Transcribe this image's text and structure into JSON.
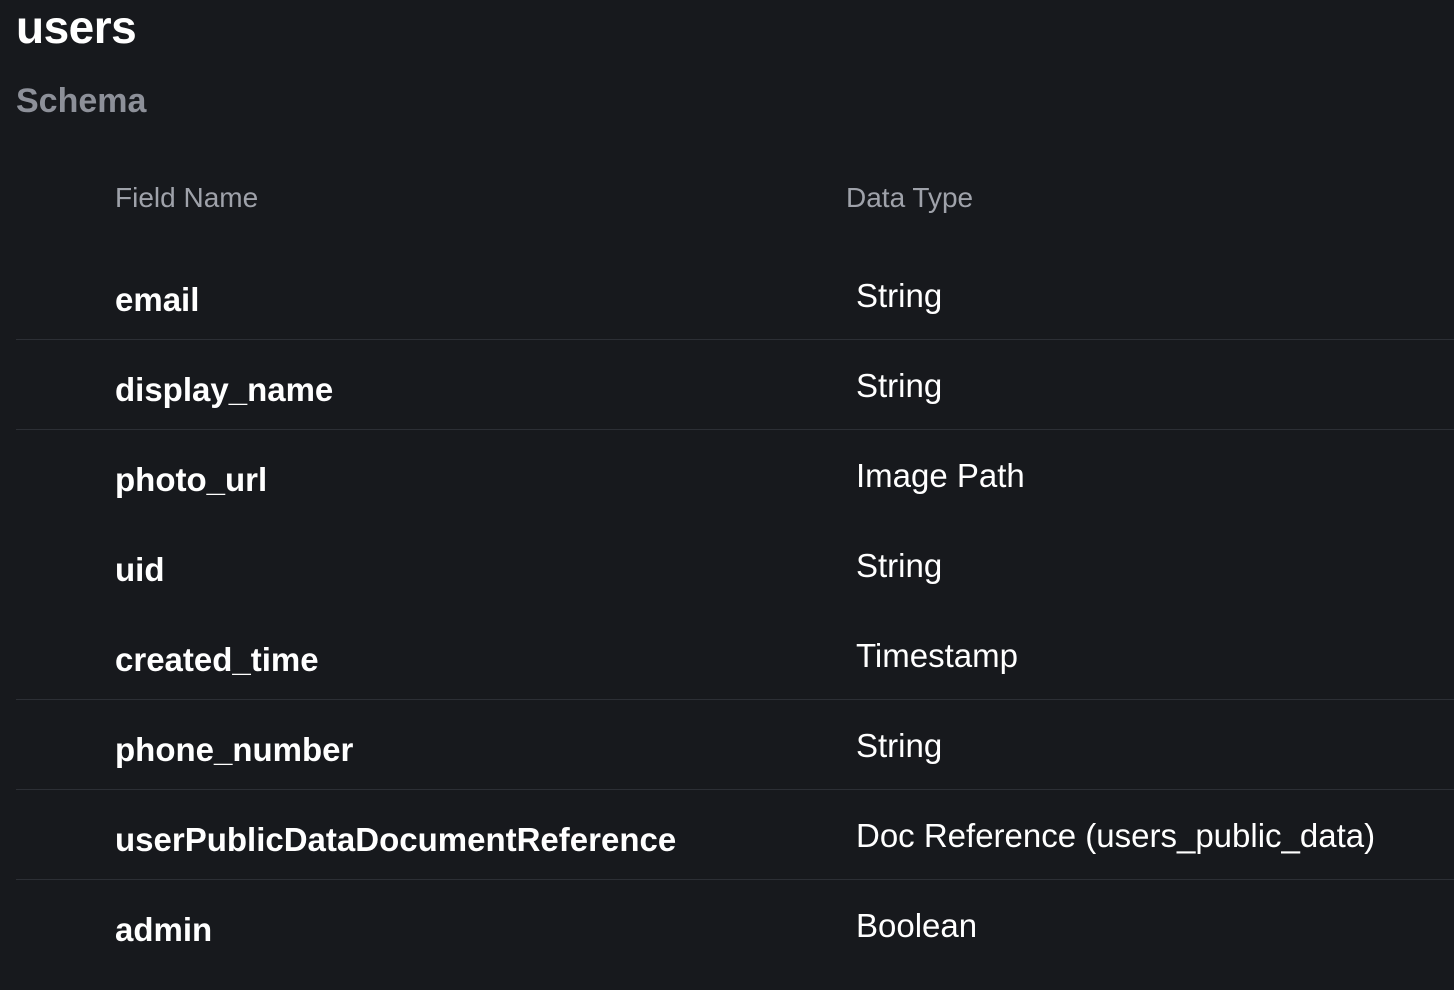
{
  "collection": {
    "title": "users",
    "section": "Schema"
  },
  "table": {
    "headers": {
      "field_name": "Field Name",
      "data_type": "Data Type"
    },
    "rows": [
      {
        "name": "email",
        "type": "String"
      },
      {
        "name": "display_name",
        "type": "String"
      },
      {
        "name": "photo_url",
        "type": "Image Path"
      },
      {
        "name": "uid",
        "type": "String"
      },
      {
        "name": "created_time",
        "type": "Timestamp"
      },
      {
        "name": "phone_number",
        "type": "String"
      },
      {
        "name": "userPublicDataDocumentReference",
        "type": "Doc Reference (users_public_data)"
      },
      {
        "name": "admin",
        "type": "Boolean"
      }
    ]
  },
  "colors": {
    "background": "#17191d",
    "text": "#ffffff",
    "muted_text": "#8d9099",
    "divider": "#2c2f35"
  }
}
